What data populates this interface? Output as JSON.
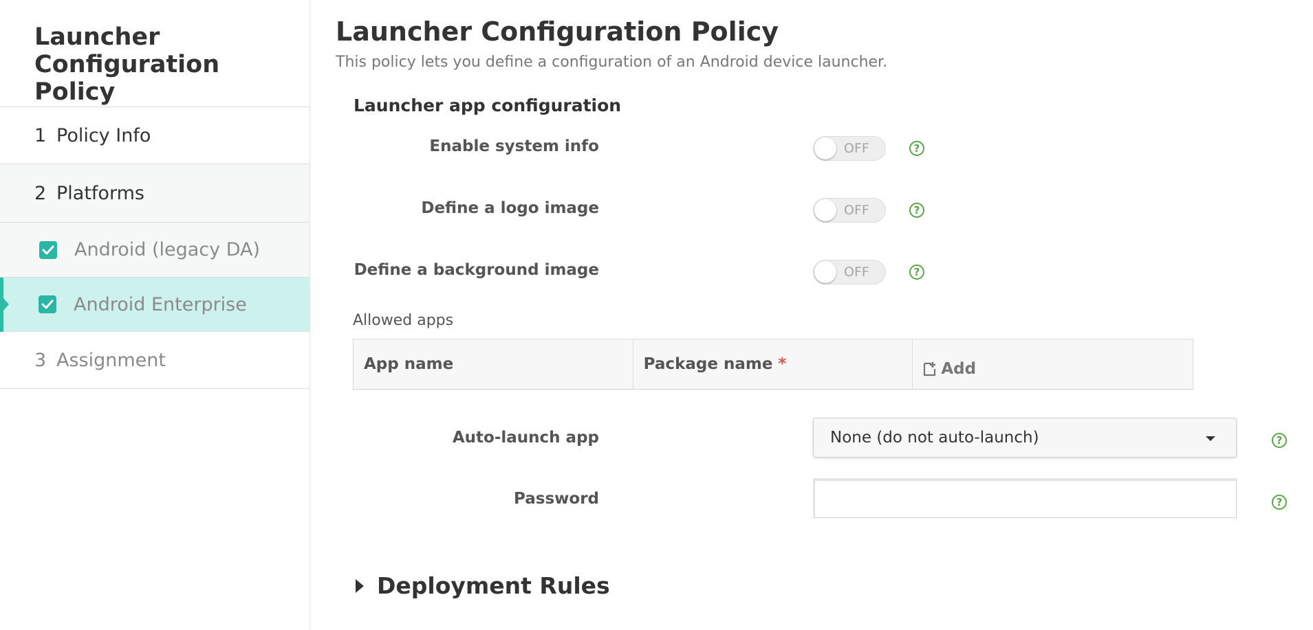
{
  "sidebar": {
    "title": "Launcher Configuration Policy",
    "steps": [
      {
        "number": "1",
        "label": "Policy Info"
      },
      {
        "number": "2",
        "label": "Platforms"
      },
      {
        "number": "3",
        "label": "Assignment"
      }
    ],
    "platforms": [
      {
        "label": "Android (legacy DA)",
        "checked": true
      },
      {
        "label": "Android Enterprise",
        "checked": true,
        "active": true
      }
    ]
  },
  "main": {
    "title": "Launcher Configuration Policy",
    "description": "This policy lets you define a configuration of an Android device launcher.",
    "section_title": "Launcher app configuration",
    "toggles": [
      {
        "label": "Enable system info",
        "state": "OFF"
      },
      {
        "label": "Define a logo image",
        "state": "OFF"
      },
      {
        "label": "Define a background image",
        "state": "OFF"
      }
    ],
    "help_glyph": "?",
    "allowed_apps": {
      "label": "Allowed apps",
      "columns": [
        "App name",
        "Package name"
      ],
      "required_marker": "*",
      "add_label": "Add"
    },
    "auto_launch": {
      "label": "Auto-launch app",
      "selected": "None (do not auto-launch)"
    },
    "password": {
      "label": "Password",
      "value": "",
      "placeholder": ""
    },
    "deployment_rules": {
      "label": "Deployment Rules"
    }
  },
  "colors": {
    "accent": "#2ab6a2",
    "active_nav_bg": "#cdf2ee",
    "help_icon": "#5aa546",
    "required": "#d9534f"
  },
  "icons": {
    "checkbox": "checkmark-icon",
    "help": "help-circle-icon",
    "add": "add-document-icon",
    "dropdown": "caret-down-icon",
    "expand": "caret-right-icon"
  }
}
